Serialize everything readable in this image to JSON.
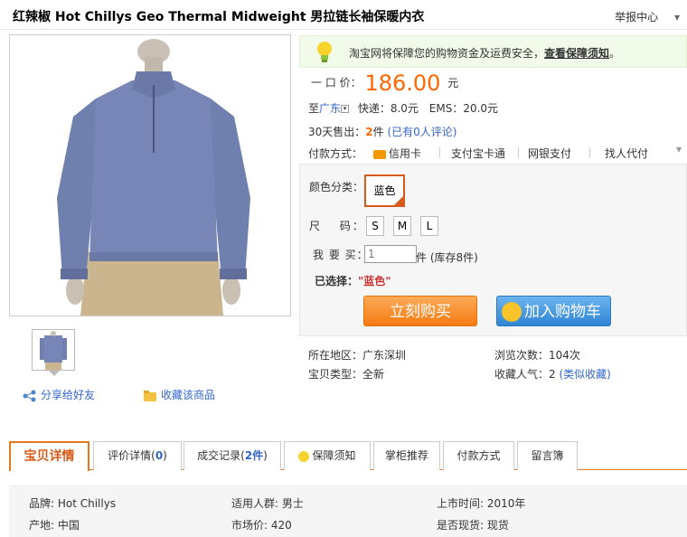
{
  "title": "红辣椒 Hot Chillys Geo Thermal Midweight 男拉链长袖保暖内衣",
  "report_label": "举报中心",
  "notice": {
    "text": "淘宝网将保障您的购物资金及运费安全，",
    "link": "查看保障须知"
  },
  "price": {
    "label": "一 口 价：",
    "value": "186.00",
    "unit": "元"
  },
  "shipping": {
    "prefix": "至",
    "location": "广东",
    "express": "快递：8.0元",
    "ems": "EMS：20.0元"
  },
  "sold": {
    "label": "30天售出：",
    "count": "2",
    "unit": "件",
    "reviews": "(已有0人评论)"
  },
  "payment": {
    "label": "付款方式：",
    "methods": [
      "信用卡",
      "支付宝卡通",
      "网银支付",
      "找人代付"
    ]
  },
  "sku": {
    "color_label": "颜色分类：",
    "color_value": "蓝色",
    "size_label": "尺　 码：",
    "sizes": [
      "S",
      "M",
      "L"
    ],
    "qty_label": "我 要 买：",
    "qty_value": "1",
    "qty_tail": "件 (库存8件)",
    "selected_label": "已选择：",
    "selected_value": "\"蓝色\""
  },
  "buttons": {
    "buy": "立刻购买",
    "cart": "加入购物车"
  },
  "details": {
    "location_label": "所在地区：",
    "location_value": "广东深圳",
    "views_label": "浏览次数：",
    "views_value": "104次",
    "type_label": "宝贝类型：",
    "type_value": "全新",
    "fav_label": "收藏人气：",
    "fav_value": "2",
    "fav_link": "(类似收藏)"
  },
  "actions": {
    "share": "分享给好友",
    "favorite": "收藏该商品"
  },
  "tabs": {
    "details": "宝贝详情",
    "reviews": "评价详情(",
    "reviews_count": "0",
    "reviews_close": ")",
    "records": "成交记录(",
    "records_count": "2件",
    "records_close": ")",
    "guarantee": "保障须知",
    "shelf": "掌柜推荐",
    "pay": "付款方式",
    "msg": "留言簿"
  },
  "attributes": [
    {
      "text": "品牌: Hot Chillys"
    },
    {
      "text": "适用人群: 男士"
    },
    {
      "text": "上市时间: 2010年"
    },
    {
      "text": "产地: 中国"
    },
    {
      "text": "市场价: 420"
    },
    {
      "text": "是否现货: 现货"
    }
  ],
  "colors": {
    "price": "#ff6600",
    "link": "#3366cc",
    "accent": "#e47a1f",
    "cart": "#2f85d4"
  }
}
